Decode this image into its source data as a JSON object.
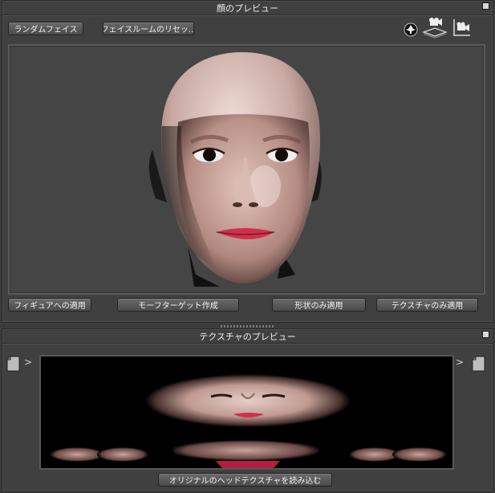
{
  "face_preview": {
    "title": "顔のプレビュー",
    "buttons": {
      "random_face": "ランダムフェイス",
      "reset_face_room": "フェイスルームのリセッ..."
    },
    "icons": [
      "rotate-icon",
      "camera-floor-icon",
      "camera-side-icon"
    ],
    "actions": {
      "apply_to_figure": "フィギュアへの適用",
      "create_morph_target": "モーフターゲット作成",
      "apply_shape_only": "形状のみ適用",
      "apply_texture_only": "テクスチャのみ適用"
    }
  },
  "texture_preview": {
    "title": "テクスチャのプレビュー",
    "load_original_texture": "オリジナルのヘッドテクスチャを読み込む"
  }
}
